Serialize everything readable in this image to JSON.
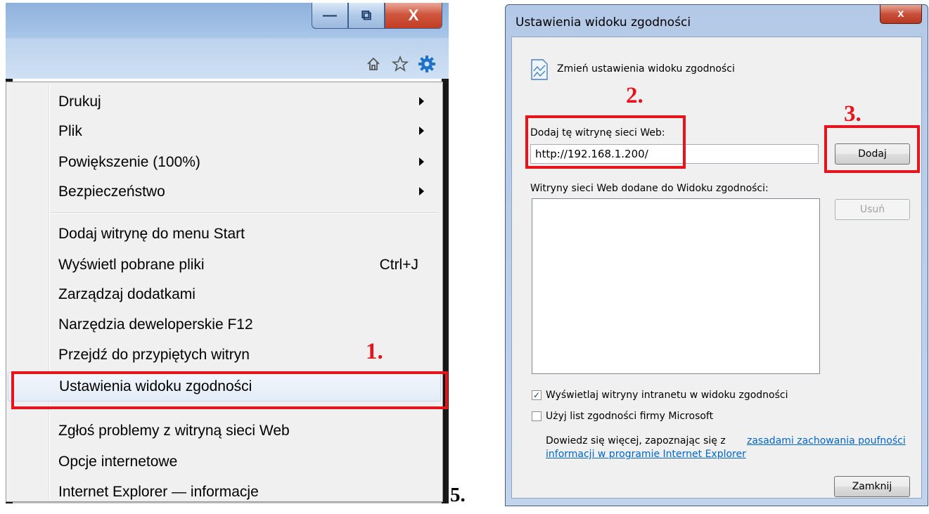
{
  "ie_window": {
    "window_buttons": {
      "minimize": "—",
      "maximize": "⧉",
      "close": "X"
    },
    "toolbar_icons": [
      "home-icon",
      "star-icon",
      "gear-icon"
    ],
    "accent_color": "#1e73c8"
  },
  "tools_menu": {
    "items": [
      {
        "label": "Drukuj",
        "submenu": true
      },
      {
        "label": "Plik",
        "submenu": true
      },
      {
        "label": "Powiększenie (100%)",
        "submenu": true
      },
      {
        "label": "Bezpieczeństwo",
        "submenu": true
      },
      {
        "label": "Dodaj witrynę do menu Start"
      },
      {
        "label": "Wyświetl pobrane pliki",
        "shortcut": "Ctrl+J"
      },
      {
        "label": "Zarządzaj dodatkami"
      },
      {
        "label": "Narzędzia deweloperskie F12"
      },
      {
        "label": "Przejdź do przypiętych witryn"
      },
      {
        "label": "Ustawienia widoku zgodności",
        "highlighted": true
      },
      {
        "label": "Zgłoś problemy z witryną sieci Web"
      },
      {
        "label": "Opcje internetowe"
      },
      {
        "label": "Internet Explorer — informacje"
      }
    ]
  },
  "annotations": {
    "step1": "1.",
    "step2": "2.",
    "step3": "3.",
    "step5": "5.",
    "highlight_color": "#e8141c"
  },
  "dialog": {
    "title": "Ustawienia widoku zgodności",
    "close_label": "x",
    "heading": "Zmień ustawienia widoku zgodności",
    "add_label": "Dodaj tę witrynę sieci Web:",
    "url_value": "http://192.168.1.200/",
    "add_button": "Dodaj",
    "list_label": "Witryny sieci Web dodane do Widoku zgodności:",
    "remove_button": "Usuń",
    "checkbox_intranet": {
      "label": "Wyświetlaj witryny intranetu w widoku zgodności",
      "checked": true
    },
    "checkbox_microsoft": {
      "label": "Użyj list zgodności firmy Microsoft",
      "checked": false
    },
    "info_text": "Dowiedz się więcej, zapoznając się z",
    "link_line1": "zasadami zachowania poufności",
    "link_line2": "informacji w programie Internet Explorer",
    "close_button": "Zamknij"
  }
}
